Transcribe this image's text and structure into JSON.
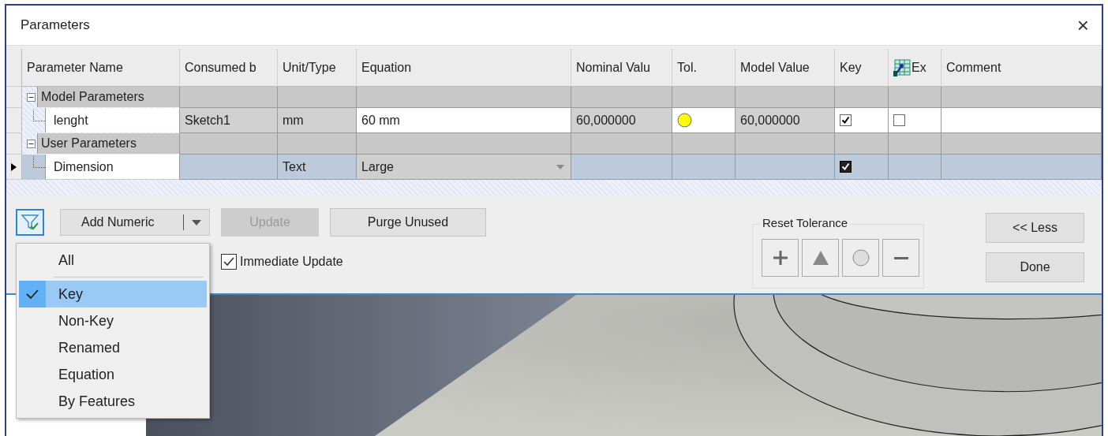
{
  "window": {
    "title": "Parameters",
    "close": "×"
  },
  "table": {
    "columns": [
      {
        "label": "Parameter Name"
      },
      {
        "label": "Consumed b"
      },
      {
        "label": "Unit/Type"
      },
      {
        "label": "Equation"
      },
      {
        "label": "Nominal Valu"
      },
      {
        "label": "Tol."
      },
      {
        "label": "Model Value"
      },
      {
        "label": "Key"
      },
      {
        "label": "Ex",
        "kind": "icon"
      },
      {
        "label": "Comment"
      }
    ],
    "groups": [
      {
        "name": "Model Parameters",
        "expanded": true,
        "children": [
          {
            "name": "lenght",
            "consumed_by": "Sketch1",
            "unit": "mm",
            "equation": "60 mm",
            "nominal": "60,000000",
            "tolerance_indicator": true,
            "model_value": "60,000000",
            "key": true,
            "export": false,
            "selected": false,
            "equation_dropdown": false
          }
        ]
      },
      {
        "name": "User Parameters",
        "expanded": true,
        "children": [
          {
            "name": "Dimension",
            "unit": "Text",
            "tolerance_indicator": false,
            "equation": "Large",
            "key": true,
            "selected": true,
            "equation_dropdown": true
          }
        ]
      }
    ]
  },
  "toolbar": {
    "filter": {
      "selected": true
    },
    "add": {
      "label": "Add Numeric"
    },
    "update": {
      "label": "Update",
      "disabled": true
    },
    "purge": {
      "label": "Purge Unused"
    }
  },
  "immediate_update": {
    "label": "Immediate Update",
    "checked": true
  },
  "reset_tolerance": {
    "label": "Reset Tolerance",
    "buttons": [
      {
        "kind": "plus"
      },
      {
        "kind": "triangle"
      },
      {
        "kind": "circle"
      },
      {
        "kind": "minus"
      }
    ]
  },
  "buttons": [
    {
      "label": "<< Less"
    },
    {
      "label": "Done"
    }
  ],
  "filter_menu": {
    "items": [
      {
        "kind": "item",
        "label": "All",
        "selected": false
      },
      {
        "kind": "separator"
      },
      {
        "kind": "item",
        "label": "Key",
        "selected": true
      },
      {
        "kind": "item",
        "label": "Non-Key",
        "selected": false
      },
      {
        "kind": "item",
        "label": "Renamed",
        "selected": false
      },
      {
        "kind": "item",
        "label": "Equation",
        "selected": false
      },
      {
        "kind": "item",
        "label": "By Features",
        "selected": false
      }
    ]
  }
}
